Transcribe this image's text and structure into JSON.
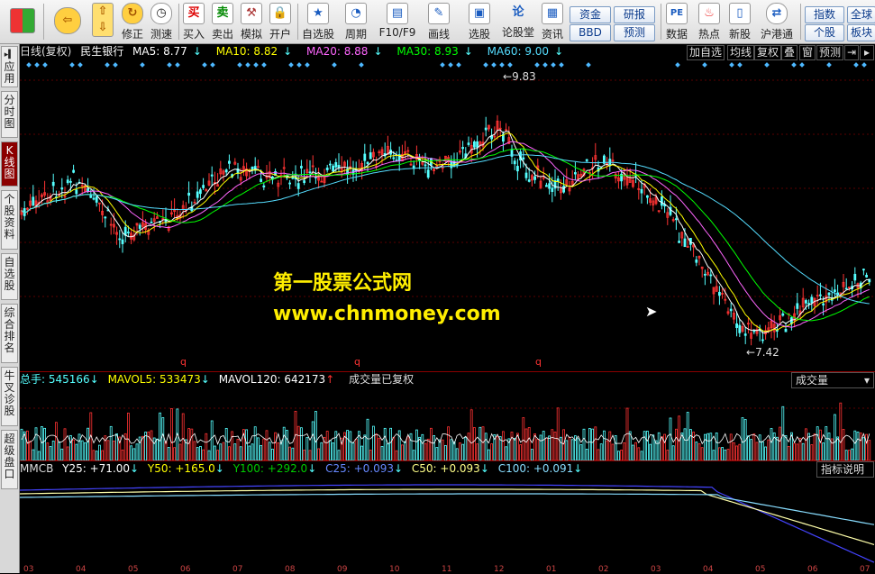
{
  "toolbar": {
    "items": [
      {
        "label": "",
        "icon": "windows-logo-icon"
      },
      {
        "label": "",
        "icon": "back-arrow-icon"
      },
      {
        "label": "",
        "icon": "up-down-arrow-icon"
      },
      {
        "label": "修正",
        "icon": "refresh-icon"
      },
      {
        "label": "测速",
        "icon": "clock-icon"
      },
      {
        "label": "买入",
        "icon": "buy-icon",
        "glyph": "买"
      },
      {
        "label": "卖出",
        "icon": "sell-icon",
        "glyph": "卖"
      },
      {
        "label": "模拟",
        "icon": "hammer-icon"
      },
      {
        "label": "开户",
        "icon": "lock-icon"
      },
      {
        "label": "自选股",
        "icon": "star-icon"
      },
      {
        "label": "周期",
        "icon": "cycle-icon"
      },
      {
        "label": "F10/F9",
        "icon": "f10-icon"
      },
      {
        "label": "画线",
        "icon": "pencil-icon"
      },
      {
        "label": "选股",
        "icon": "select-stock-icon"
      },
      {
        "label": "论股堂",
        "icon": "forum-icon",
        "glyph": "论"
      },
      {
        "label": "资讯",
        "icon": "news-icon"
      },
      {
        "label": "数据",
        "icon": "pe-icon",
        "glyph": "PE"
      },
      {
        "label": "热点",
        "icon": "hot-icon"
      },
      {
        "label": "新股",
        "icon": "ipo-icon"
      },
      {
        "label": "沪港通",
        "icon": "hk-connect-icon"
      }
    ],
    "small_buttons": [
      "资金",
      "BBD",
      "研报",
      "预测",
      "指数",
      "个股",
      "全球",
      "板块"
    ]
  },
  "side_tabs": [
    "应用",
    "分时图",
    "K线图",
    "个股资料",
    "自选股",
    "综合排名",
    "牛叉诊股",
    "超级盘口"
  ],
  "main": {
    "header": {
      "period": "日线(复权)",
      "stock": "民生银行",
      "ma5": "MA5: 8.77",
      "ma10": "MA10: 8.82",
      "ma20": "MA20: 8.88",
      "ma30": "MA30: 8.93",
      "ma60": "MA60: 9.00"
    },
    "buttons": [
      "加自选",
      "均线",
      "复权",
      "叠",
      "窗",
      "预测"
    ],
    "high_label": "9.83",
    "low_label": "7.42",
    "watermark_cn": "第一股票公式网",
    "watermark_url": "www.chnmoney.com",
    "q_markers": [
      "q",
      "q",
      "q"
    ],
    "colors": {
      "ma5": "#ffffff",
      "ma10": "#ffff00",
      "ma20": "#ff66ff",
      "ma30": "#00ff00",
      "ma60": "#55ddff",
      "up": "#ff3333",
      "down": "#55ffff"
    }
  },
  "volume": {
    "total": "总手: 545166",
    "mavol5": "MAVOL5: 533473",
    "mavol120": "MAVOL120: 642173",
    "note": "成交量已复权",
    "dropdown": "成交量"
  },
  "indicator": {
    "title": "MMCB",
    "y25": "Y25: +71.00",
    "y50": "Y50: +165.0",
    "y100": "Y100: +292.0",
    "c25": "C25: +0.093",
    "c50": "C50: +0.093",
    "c100": "C100: +0.091",
    "button": "指标说明"
  },
  "date_axis": {
    "labels": [
      "03",
      "04",
      "05",
      "06",
      "07",
      "08",
      "09",
      "10",
      "11",
      "12",
      "01",
      "02",
      "03",
      "04",
      "05",
      "06",
      "07"
    ]
  }
}
